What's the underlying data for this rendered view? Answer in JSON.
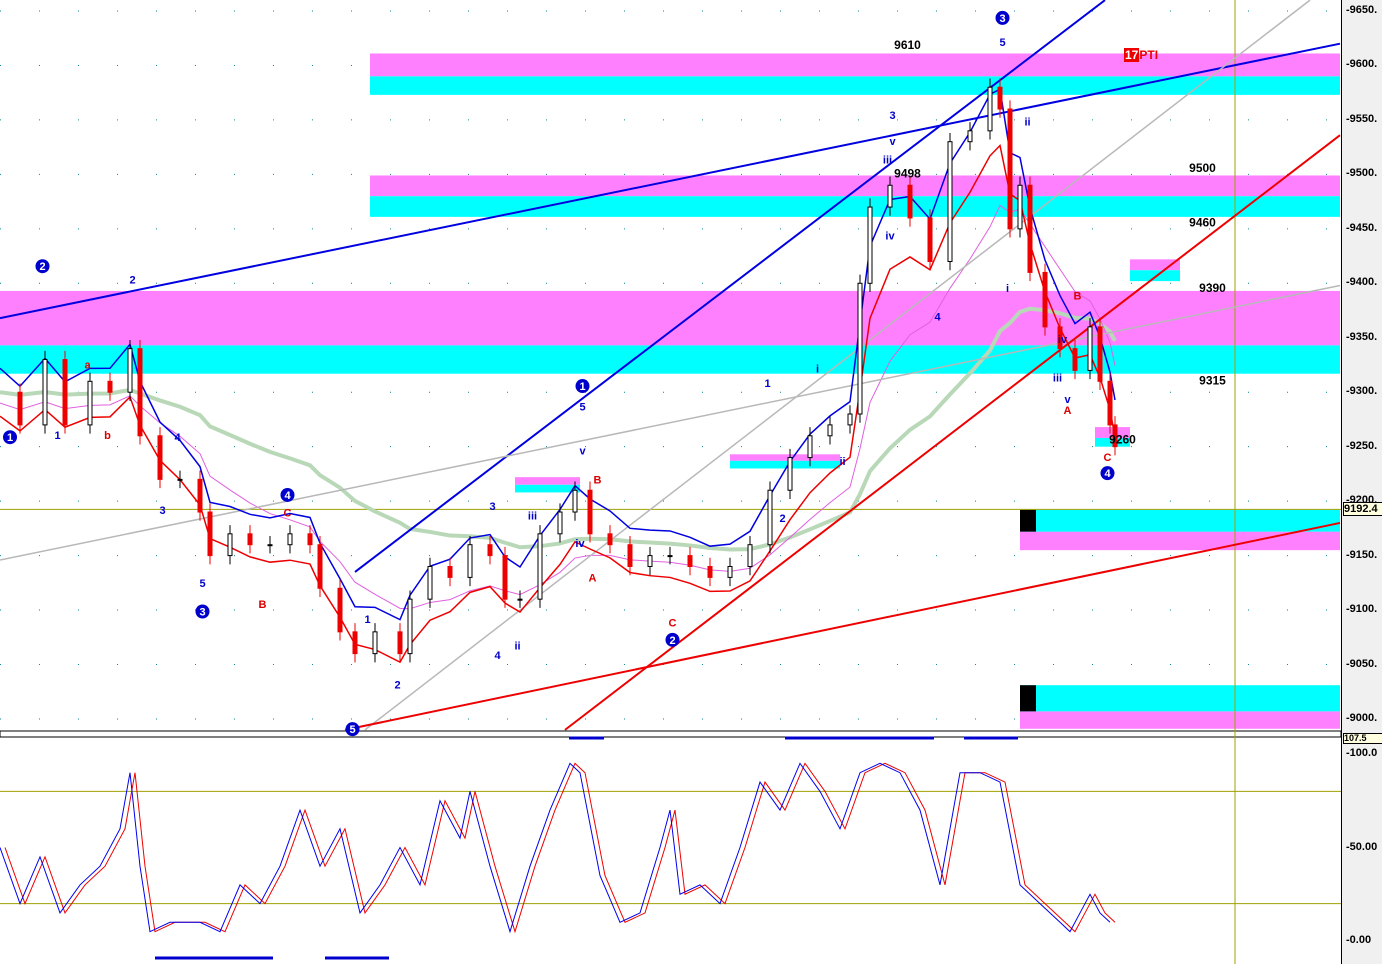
{
  "chart_data": {
    "type": "candlestick",
    "price_axis": {
      "ylim": [
        9000,
        9650
      ],
      "ticks": [
        "9650.",
        "9600.",
        "9550.",
        "9500.",
        "9450.",
        "9400.",
        "9350.",
        "9300.",
        "9250.",
        "9200.",
        "9150.",
        "9100.",
        "9050.",
        "9000."
      ],
      "current": "9192.4"
    },
    "osc_axis": {
      "ylim": [
        0,
        100
      ],
      "ticks": [
        "100.0",
        "50.00",
        "0.00"
      ],
      "current": "107.5",
      "levels": [
        80,
        20
      ]
    },
    "x_unit": "bar",
    "closes": [
      [
        0,
        9300
      ],
      [
        4,
        9270
      ],
      [
        9,
        9330
      ],
      [
        13,
        9270
      ],
      [
        18,
        9310
      ],
      [
        22,
        9300
      ],
      [
        26,
        9340
      ],
      [
        28,
        9260
      ],
      [
        32,
        9220
      ],
      [
        36,
        9220
      ],
      [
        40,
        9190
      ],
      [
        42,
        9150
      ],
      [
        46,
        9170
      ],
      [
        50,
        9160
      ],
      [
        54,
        9160
      ],
      [
        58,
        9170
      ],
      [
        62,
        9160
      ],
      [
        64,
        9120
      ],
      [
        68,
        9080
      ],
      [
        71,
        9060
      ],
      [
        75,
        9080
      ],
      [
        80,
        9060
      ],
      [
        82,
        9110
      ],
      [
        86,
        9140
      ],
      [
        90,
        9130
      ],
      [
        94,
        9160
      ],
      [
        98,
        9150
      ],
      [
        101,
        9110
      ],
      [
        104,
        9110
      ],
      [
        108,
        9170
      ],
      [
        112,
        9190
      ],
      [
        115,
        9210
      ],
      [
        118,
        9170
      ],
      [
        122,
        9160
      ],
      [
        126,
        9140
      ],
      [
        130,
        9150
      ],
      [
        134,
        9150
      ],
      [
        138,
        9140
      ],
      [
        142,
        9130
      ],
      [
        146,
        9140
      ],
      [
        150,
        9160
      ],
      [
        154,
        9210
      ],
      [
        158,
        9240
      ],
      [
        162,
        9260
      ],
      [
        166,
        9270
      ],
      [
        170,
        9280
      ],
      [
        172,
        9400
      ],
      [
        174,
        9470
      ],
      [
        178,
        9490
      ],
      [
        182,
        9460
      ],
      [
        186,
        9420
      ],
      [
        190,
        9530
      ],
      [
        194,
        9540
      ],
      [
        198,
        9580
      ],
      [
        200,
        9560
      ],
      [
        202,
        9450
      ],
      [
        204,
        9490
      ],
      [
        206,
        9410
      ],
      [
        209,
        9360
      ],
      [
        212,
        9340
      ],
      [
        215,
        9320
      ],
      [
        218,
        9360
      ],
      [
        220,
        9310
      ],
      [
        222,
        9270
      ],
      [
        223,
        9250
      ]
    ],
    "oscillator": [
      [
        0,
        50
      ],
      [
        4,
        20
      ],
      [
        8,
        45
      ],
      [
        12,
        15
      ],
      [
        16,
        30
      ],
      [
        20,
        40
      ],
      [
        24,
        60
      ],
      [
        26,
        90
      ],
      [
        28,
        40
      ],
      [
        30,
        5
      ],
      [
        34,
        10
      ],
      [
        40,
        10
      ],
      [
        44,
        5
      ],
      [
        48,
        30
      ],
      [
        52,
        20
      ],
      [
        56,
        40
      ],
      [
        60,
        70
      ],
      [
        64,
        40
      ],
      [
        68,
        60
      ],
      [
        72,
        15
      ],
      [
        76,
        30
      ],
      [
        80,
        50
      ],
      [
        84,
        30
      ],
      [
        88,
        75
      ],
      [
        92,
        55
      ],
      [
        94,
        80
      ],
      [
        98,
        40
      ],
      [
        102,
        5
      ],
      [
        106,
        40
      ],
      [
        110,
        70
      ],
      [
        114,
        95
      ],
      [
        116,
        90
      ],
      [
        120,
        35
      ],
      [
        124,
        10
      ],
      [
        128,
        15
      ],
      [
        132,
        50
      ],
      [
        134,
        70
      ],
      [
        136,
        25
      ],
      [
        140,
        30
      ],
      [
        144,
        20
      ],
      [
        148,
        50
      ],
      [
        152,
        85
      ],
      [
        156,
        70
      ],
      [
        160,
        95
      ],
      [
        164,
        80
      ],
      [
        168,
        60
      ],
      [
        172,
        90
      ],
      [
        176,
        95
      ],
      [
        180,
        90
      ],
      [
        184,
        70
      ],
      [
        188,
        30
      ],
      [
        192,
        90
      ],
      [
        196,
        90
      ],
      [
        200,
        85
      ],
      [
        204,
        30
      ],
      [
        208,
        20
      ],
      [
        212,
        10
      ],
      [
        214,
        5
      ],
      [
        216,
        15
      ],
      [
        218,
        25
      ],
      [
        220,
        15
      ],
      [
        222,
        10
      ]
    ],
    "zones": [
      {
        "x": [
          74,
          268
        ],
        "pink": [
          9590,
          9611
        ],
        "cyan": [
          9573,
          9590
        ]
      },
      {
        "x": [
          74,
          268
        ],
        "pink": [
          9480,
          9499
        ],
        "cyan": [
          9461,
          9480
        ]
      },
      {
        "x": [
          0,
          268
        ],
        "pink": [
          9343,
          9393
        ],
        "cyan": [
          9317,
          9343
        ]
      },
      {
        "x": [
          204,
          268
        ],
        "pink": [
          9155,
          9172
        ],
        "cyan": [
          9172,
          9192
        ]
      },
      {
        "x": [
          204,
          268
        ],
        "pink": [
          8991,
          9007
        ],
        "cyan": [
          9007,
          9031
        ]
      },
      {
        "x": [
          103,
          116
        ],
        "pink": [
          9215,
          9222
        ],
        "cyan": [
          9208,
          9215
        ]
      },
      {
        "x": [
          146,
          168
        ],
        "pink": [
          9237,
          9243
        ],
        "cyan": [
          9230,
          9237
        ]
      },
      {
        "x": [
          219,
          226
        ],
        "pink": [
          9268,
          9258
        ],
        "cyan": [
          9258,
          9250
        ]
      },
      {
        "x": [
          226,
          236
        ],
        "pink": [
          9412,
          9422
        ],
        "cyan": [
          9402,
          9412
        ]
      }
    ],
    "trendlines": [
      {
        "color": "#0000e0",
        "p": [
          [
            0,
            9368
          ],
          [
            268,
            9620
          ]
        ]
      },
      {
        "color": "#0000e0",
        "p": [
          [
            71,
            9135
          ],
          [
            221,
            9660
          ]
        ]
      },
      {
        "color": "#b8b8b8",
        "p": [
          [
            0,
            9146
          ],
          [
            268,
            9398
          ]
        ]
      },
      {
        "color": "#b8b8b8",
        "p": [
          [
            73,
            8990
          ],
          [
            262,
            9660
          ]
        ]
      },
      {
        "color": "#ee0000",
        "p": [
          [
            69,
            8990
          ],
          [
            268,
            9180
          ]
        ]
      },
      {
        "color": "#ee0000",
        "p": [
          [
            113,
            8990
          ],
          [
            268,
            9536
          ]
        ]
      }
    ],
    "wave_labels": [
      {
        "t": "1",
        "b": 2,
        "p": 9255,
        "c": "#0000cc",
        "circle": true
      },
      {
        "t": "2",
        "b": 8.5,
        "p": 9412,
        "c": "#0000cc",
        "circle": true
      },
      {
        "t": "2",
        "b": 26.5,
        "p": 9400,
        "c": "#0000cc"
      },
      {
        "t": "a",
        "b": 17.5,
        "p": 9322,
        "c": "#dd0000"
      },
      {
        "t": "b",
        "b": 21.5,
        "p": 9257,
        "c": "#dd0000"
      },
      {
        "t": "1",
        "b": 11.5,
        "p": 9257,
        "c": "#0000cc"
      },
      {
        "t": "3",
        "b": 32.5,
        "p": 9188,
        "c": "#0000cc"
      },
      {
        "t": "4",
        "b": 35.5,
        "p": 9255,
        "c": "#0000cc"
      },
      {
        "t": "5",
        "b": 40.5,
        "p": 9121,
        "c": "#0000cc"
      },
      {
        "t": "3",
        "b": 40.5,
        "p": 9095,
        "c": "#0000cc",
        "circle": true
      },
      {
        "t": "4",
        "b": 57.5,
        "p": 9202,
        "c": "#0000cc",
        "circle": true
      },
      {
        "t": "C",
        "b": 57.5,
        "p": 9186,
        "c": "#dd0000"
      },
      {
        "t": "B",
        "b": 52.5,
        "p": 9102,
        "c": "#dd0000"
      },
      {
        "t": "5",
        "b": 70.5,
        "p": 8987,
        "c": "#0000cc",
        "circle": true
      },
      {
        "t": "1",
        "b": 73.5,
        "p": 9088,
        "c": "#0000cc"
      },
      {
        "t": "2",
        "b": 79.5,
        "p": 9028,
        "c": "#0000cc"
      },
      {
        "t": "3",
        "b": 98.5,
        "p": 9192,
        "c": "#0000cc"
      },
      {
        "t": "4",
        "b": 99.5,
        "p": 9055,
        "c": "#0000cc"
      },
      {
        "t": "ii",
        "b": 103.5,
        "p": 9064,
        "c": "#0000cc"
      },
      {
        "t": "iii",
        "b": 106.5,
        "p": 9183,
        "c": "#0000cc"
      },
      {
        "t": "v",
        "b": 116.5,
        "p": 9243,
        "c": "#0000cc"
      },
      {
        "t": "iv",
        "b": 116,
        "p": 9158,
        "c": "#0000cc"
      },
      {
        "t": "1",
        "b": 116.5,
        "p": 9302,
        "c": "#0000cc",
        "circle": true
      },
      {
        "t": "5",
        "b": 116.5,
        "p": 9283,
        "c": "#0000cc"
      },
      {
        "t": "B",
        "b": 119.5,
        "p": 9216,
        "c": "#dd0000"
      },
      {
        "t": "A",
        "b": 118.5,
        "p": 9126,
        "c": "#dd0000"
      },
      {
        "t": "C",
        "b": 134.5,
        "p": 9085,
        "c": "#dd0000"
      },
      {
        "t": "2",
        "b": 134.5,
        "p": 9069,
        "c": "#0000cc",
        "circle": true
      },
      {
        "t": "1",
        "b": 153.5,
        "p": 9305,
        "c": "#0000cc"
      },
      {
        "t": "2",
        "b": 156.5,
        "p": 9181,
        "c": "#0000cc"
      },
      {
        "t": "i",
        "b": 163.5,
        "p": 9318,
        "c": "#0000cc"
      },
      {
        "t": "ii",
        "b": 168.5,
        "p": 9233,
        "c": "#0000cc"
      },
      {
        "t": "3",
        "b": 178.5,
        "p": 9551,
        "c": "#0000cc"
      },
      {
        "t": "v",
        "b": 178.5,
        "p": 9527,
        "c": "#0000cc"
      },
      {
        "t": "iii",
        "b": 177.5,
        "p": 9510,
        "c": "#0000cc"
      },
      {
        "t": "iv",
        "b": 178,
        "p": 9440,
        "c": "#0000cc"
      },
      {
        "t": "4",
        "b": 187.5,
        "p": 9366,
        "c": "#0000cc"
      },
      {
        "t": "3",
        "b": 200.5,
        "p": 9640,
        "c": "#0000cc",
        "circle": true
      },
      {
        "t": "5",
        "b": 200.5,
        "p": 9618,
        "c": "#0000cc"
      },
      {
        "t": "ii",
        "b": 205.5,
        "p": 9545,
        "c": "#0000cc"
      },
      {
        "t": "i",
        "b": 201.5,
        "p": 9392,
        "c": "#0000cc"
      },
      {
        "t": "iv",
        "b": 212.5,
        "p": 9345,
        "c": "#0000cc"
      },
      {
        "t": "iii",
        "b": 211.5,
        "p": 9310,
        "c": "#0000cc"
      },
      {
        "t": "B",
        "b": 215.5,
        "p": 9385,
        "c": "#dd0000"
      },
      {
        "t": "v",
        "b": 213.5,
        "p": 9290,
        "c": "#0000cc"
      },
      {
        "t": "A",
        "b": 213.5,
        "p": 9280,
        "c": "#dd0000"
      },
      {
        "t": "C",
        "b": 221.5,
        "p": 9237,
        "c": "#dd0000"
      },
      {
        "t": "4",
        "b": 221.5,
        "p": 9222,
        "c": "#0000cc",
        "circle": true
      }
    ],
    "price_labels": [
      {
        "t": "9610",
        "b": 181.5,
        "p": 9615
      },
      {
        "t": "9498",
        "b": 181.5,
        "p": 9497
      },
      {
        "t": "9500",
        "b": 240.5,
        "p": 9502
      },
      {
        "t": "9460",
        "b": 240.5,
        "p": 9452
      },
      {
        "t": "9390",
        "b": 242.5,
        "p": 9392
      },
      {
        "t": "9315",
        "b": 242.5,
        "p": 9307
      },
      {
        "t": "9260",
        "b": 224.5,
        "p": 9253
      }
    ],
    "pti_label": {
      "num": "17",
      "text": "PTI"
    },
    "colors": {
      "pink": "#ff80ff",
      "cyan": "#00ffff",
      "fast_ma": "#0000e0",
      "slow_ma": "#ee0000",
      "long_ma": "#b8d8b8",
      "olive": "#a0a000"
    }
  }
}
